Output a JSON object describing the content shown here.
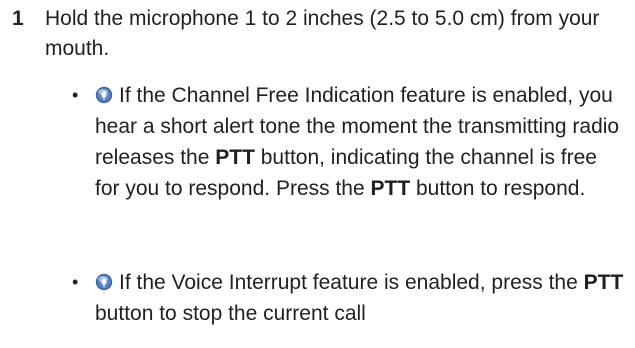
{
  "step": {
    "number": "1",
    "text": "Hold the microphone 1 to 2 inches (2.5 to 5.0 cm) from your mouth."
  },
  "bullets": [
    {
      "bullet_glyph": "•",
      "icon": "feature-icon",
      "segments": [
        "If the Channel Free Indication feature is enabled, you hear a short alert tone the moment the transmitting radio releases the ",
        "PTT",
        " button, indicating the channel is free for you to respond. Press the ",
        "PTT",
        " button to respond."
      ]
    },
    {
      "bullet_glyph": "•",
      "icon": "feature-icon",
      "segments": [
        "If the Voice Interrupt feature is enabled, press the ",
        "PTT",
        " button to stop the current call"
      ]
    }
  ],
  "colors": {
    "text": "#231f20",
    "icon_fill": "#3f68a8",
    "icon_highlight": "#a9c4e8"
  }
}
